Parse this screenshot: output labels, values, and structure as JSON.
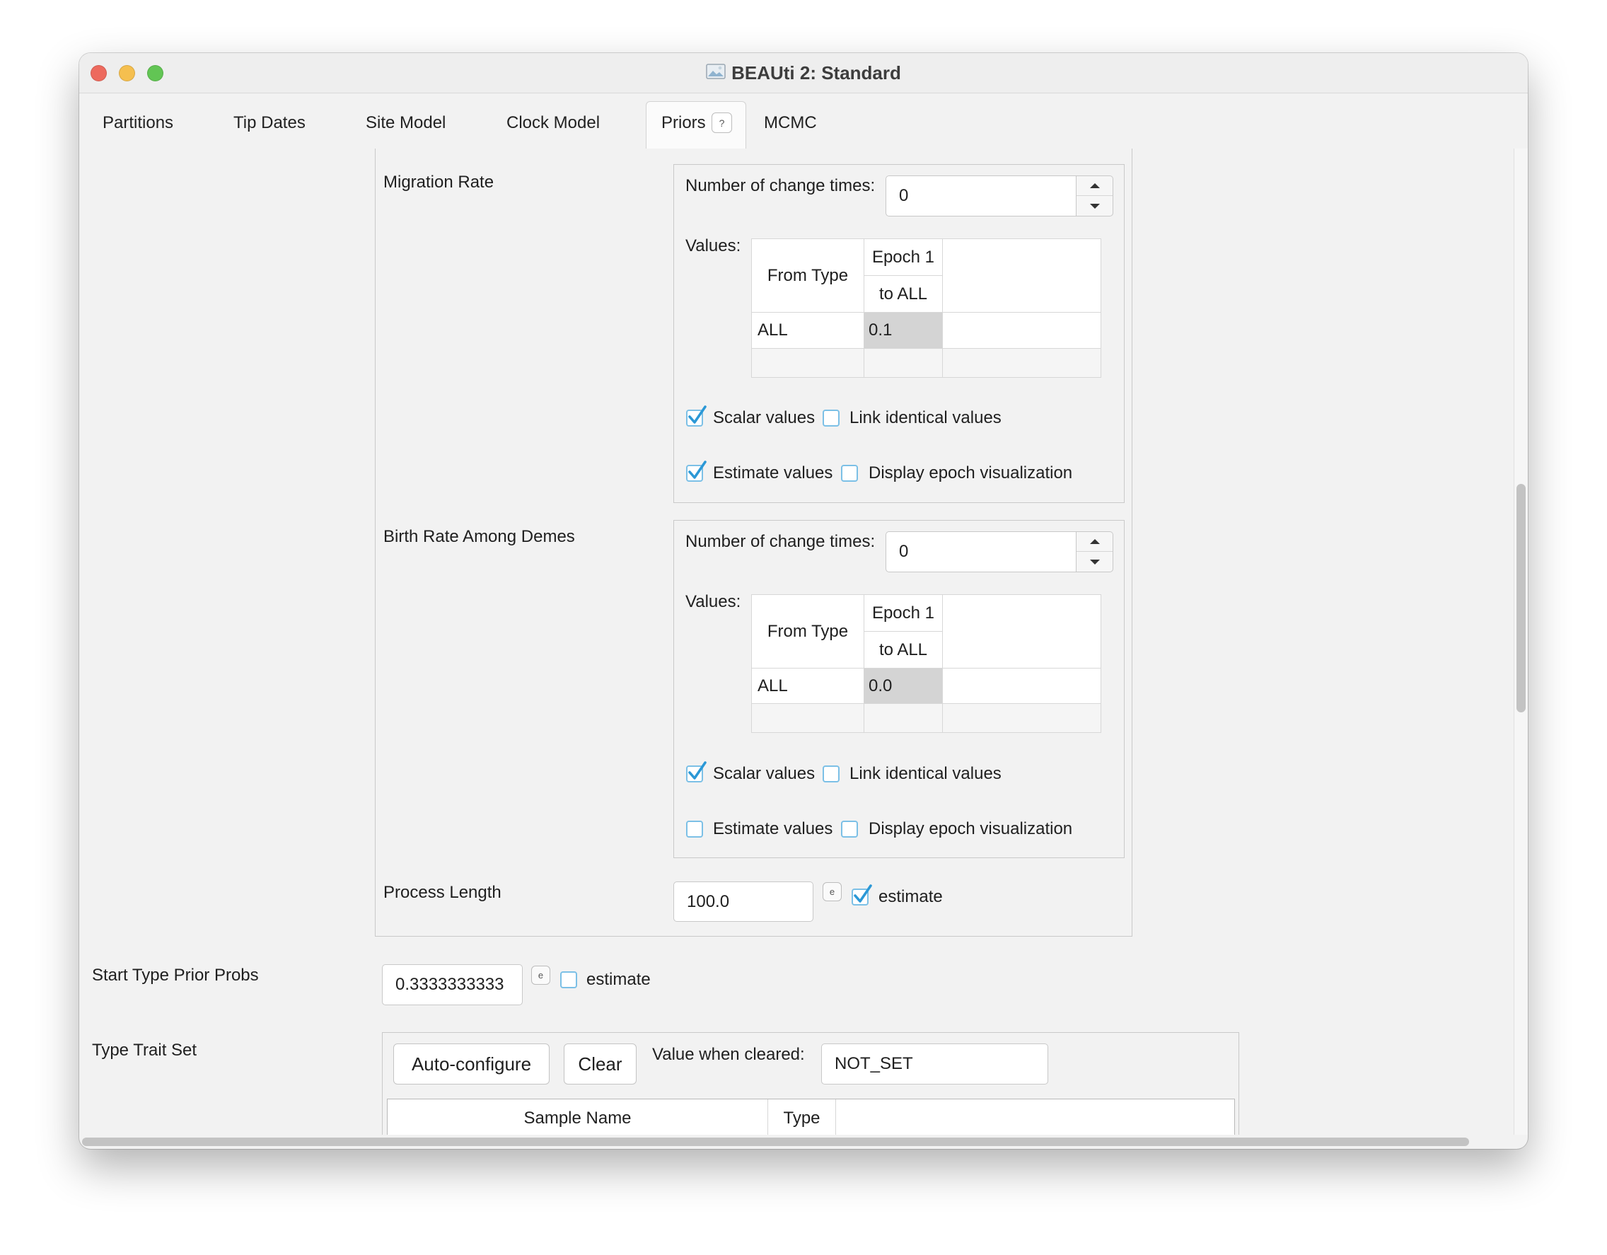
{
  "window": {
    "title": "BEAUti 2: Standard",
    "title_icon": "document-image-icon",
    "traffic_lights": {
      "close": "#ed6a5e",
      "minimize": "#f5bf4f",
      "zoom": "#62c554"
    }
  },
  "tabs": [
    {
      "label": "Partitions",
      "selected": false
    },
    {
      "label": "Tip Dates",
      "selected": false
    },
    {
      "label": "Site Model",
      "selected": false
    },
    {
      "label": "Clock Model",
      "selected": false
    },
    {
      "label": "Priors",
      "selected": true,
      "help_badge": "?"
    },
    {
      "label": "MCMC",
      "selected": false
    }
  ],
  "priors": {
    "migration_rate": {
      "label": "Migration Rate",
      "change_times_label": "Number of change times:",
      "change_times_value": "0",
      "values_label": "Values:",
      "table": {
        "row_header": "From Type",
        "columns": [
          {
            "epoch": "Epoch 1",
            "to": "to ALL"
          }
        ],
        "rows": [
          {
            "from": "ALL",
            "values": [
              "0.1"
            ]
          }
        ]
      },
      "scalar_values": {
        "label": "Scalar values",
        "checked": true
      },
      "link_identical_values": {
        "label": "Link identical values",
        "checked": false
      },
      "estimate_values": {
        "label": "Estimate values",
        "checked": true
      },
      "display_epoch_visualization": {
        "label": "Display epoch visualization",
        "checked": false
      }
    },
    "birth_rate_among_demes": {
      "label": "Birth Rate Among Demes",
      "change_times_label": "Number of change times:",
      "change_times_value": "0",
      "values_label": "Values:",
      "table": {
        "row_header": "From Type",
        "columns": [
          {
            "epoch": "Epoch 1",
            "to": "to ALL"
          }
        ],
        "rows": [
          {
            "from": "ALL",
            "values": [
              "0.0"
            ]
          }
        ]
      },
      "scalar_values": {
        "label": "Scalar values",
        "checked": true
      },
      "link_identical_values": {
        "label": "Link identical values",
        "checked": false
      },
      "estimate_values": {
        "label": "Estimate values",
        "checked": false
      },
      "display_epoch_visualization": {
        "label": "Display epoch visualization",
        "checked": false
      }
    },
    "process_length": {
      "label": "Process Length",
      "value": "100.0",
      "edit_button": "e",
      "estimate": {
        "label": "estimate",
        "checked": true
      }
    },
    "start_type_prior_probs": {
      "label": "Start Type Prior Probs",
      "value": "0.3333333333",
      "edit_button": "e",
      "estimate": {
        "label": "estimate",
        "checked": false
      }
    },
    "type_trait_set": {
      "label": "Type Trait Set",
      "auto_configure_label": "Auto-configure",
      "clear_label": "Clear",
      "value_when_cleared_label": "Value when cleared:",
      "value_when_cleared": "NOT_SET",
      "columns": [
        "Sample Name",
        "Type"
      ]
    }
  },
  "colors": {
    "accent": "#2b98d6",
    "checkbox_border": "#7cc0e6",
    "selected_cell": "#d4d4d4",
    "window_background": "#f2f2f2"
  }
}
